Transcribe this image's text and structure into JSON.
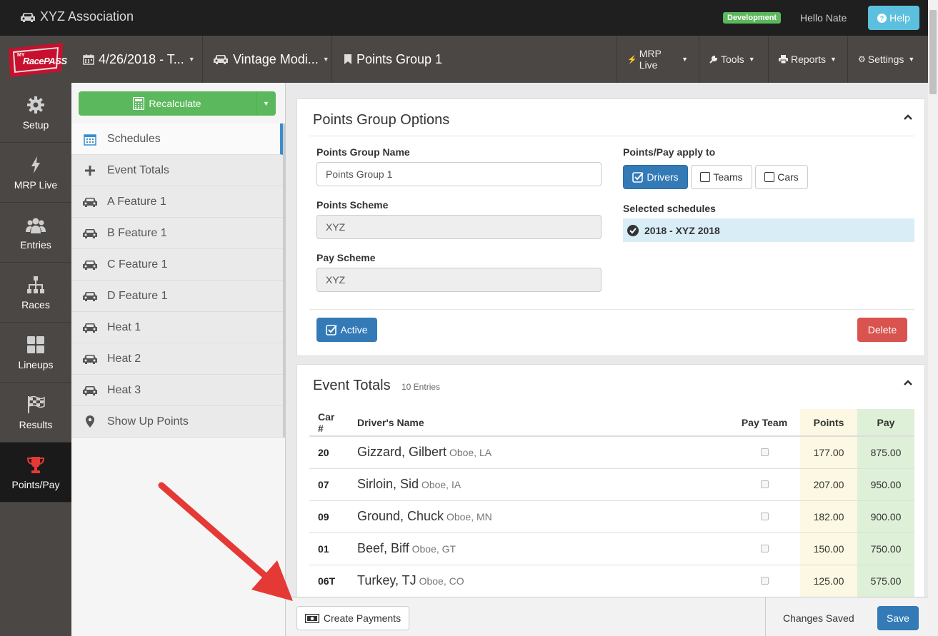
{
  "topbar": {
    "brand": "XYZ Association",
    "env_badge": "Development",
    "greeting": "Hello Nate",
    "help_label": "Help"
  },
  "navbar": {
    "logo_text": "RacePASS",
    "logo_small": "MY",
    "date_selector": "4/26/2018 - T...",
    "class_selector": "Vintage Modi...",
    "points_group": "Points Group 1",
    "menus": [
      "MRP Live",
      "Tools",
      "Reports",
      "Settings"
    ]
  },
  "sidebar": {
    "items": [
      {
        "label": "Setup",
        "icon": "gear-icon"
      },
      {
        "label": "MRP Live",
        "icon": "bolt-icon"
      },
      {
        "label": "Entries",
        "icon": "users-icon"
      },
      {
        "label": "Races",
        "icon": "sitemap-icon"
      },
      {
        "label": "Lineups",
        "icon": "grid-icon"
      },
      {
        "label": "Results",
        "icon": "checkered-flag-icon"
      },
      {
        "label": "Points/Pay",
        "icon": "trophy-icon",
        "active": true
      }
    ]
  },
  "menu_panel": {
    "recalculate_label": "Recalculate",
    "items": [
      {
        "label": "Schedules",
        "icon": "calendar-icon",
        "selected": true
      },
      {
        "label": "Event Totals",
        "icon": "plus-icon"
      },
      {
        "label": "A Feature 1",
        "icon": "car-icon"
      },
      {
        "label": "B Feature 1",
        "icon": "car-icon"
      },
      {
        "label": "C Feature 1",
        "icon": "car-icon"
      },
      {
        "label": "D Feature 1",
        "icon": "car-icon"
      },
      {
        "label": "Heat 1",
        "icon": "car-icon"
      },
      {
        "label": "Heat 2",
        "icon": "car-icon"
      },
      {
        "label": "Heat 3",
        "icon": "car-icon"
      },
      {
        "label": "Show Up Points",
        "icon": "map-marker-icon"
      }
    ]
  },
  "options": {
    "title": "Points Group Options",
    "name_label": "Points Group Name",
    "name_value": "Points Group 1",
    "scheme_label": "Points Scheme",
    "scheme_value": "XYZ",
    "pay_label": "Pay Scheme",
    "pay_value": "XYZ",
    "apply_label": "Points/Pay apply to",
    "apply_options": [
      {
        "label": "Drivers",
        "checked": true
      },
      {
        "label": "Teams",
        "checked": false
      },
      {
        "label": "Cars",
        "checked": false
      }
    ],
    "selected_label": "Selected schedules",
    "selected_schedule": "2018 - XYZ 2018",
    "active_label": "Active",
    "delete_label": "Delete"
  },
  "totals": {
    "title": "Event Totals",
    "count": "10 Entries",
    "headers": {
      "car": "Car #",
      "driver": "Driver's Name",
      "pay_team": "Pay Team",
      "points": "Points",
      "pay": "Pay"
    },
    "rows": [
      {
        "car": "20",
        "name": "Gizzard, Gilbert",
        "loc": "Oboe, LA",
        "points": "177.00",
        "pay": "875.00"
      },
      {
        "car": "07",
        "name": "Sirloin, Sid",
        "loc": "Oboe, IA",
        "points": "207.00",
        "pay": "950.00"
      },
      {
        "car": "09",
        "name": "Ground, Chuck",
        "loc": "Oboe, MN",
        "points": "182.00",
        "pay": "900.00"
      },
      {
        "car": "01",
        "name": "Beef, Biff",
        "loc": "Oboe, GT",
        "points": "150.00",
        "pay": "750.00"
      },
      {
        "car": "06T",
        "name": "Turkey, TJ",
        "loc": "Oboe, CO",
        "points": "125.00",
        "pay": "575.00"
      }
    ]
  },
  "footer": {
    "create_payments": "Create Payments",
    "status": "Changes Saved",
    "save": "Save"
  },
  "colors": {
    "primary": "#337ab7",
    "success": "#5cb85c",
    "danger": "#d9534f",
    "info": "#5bc0de",
    "arrow": "#e53935"
  }
}
